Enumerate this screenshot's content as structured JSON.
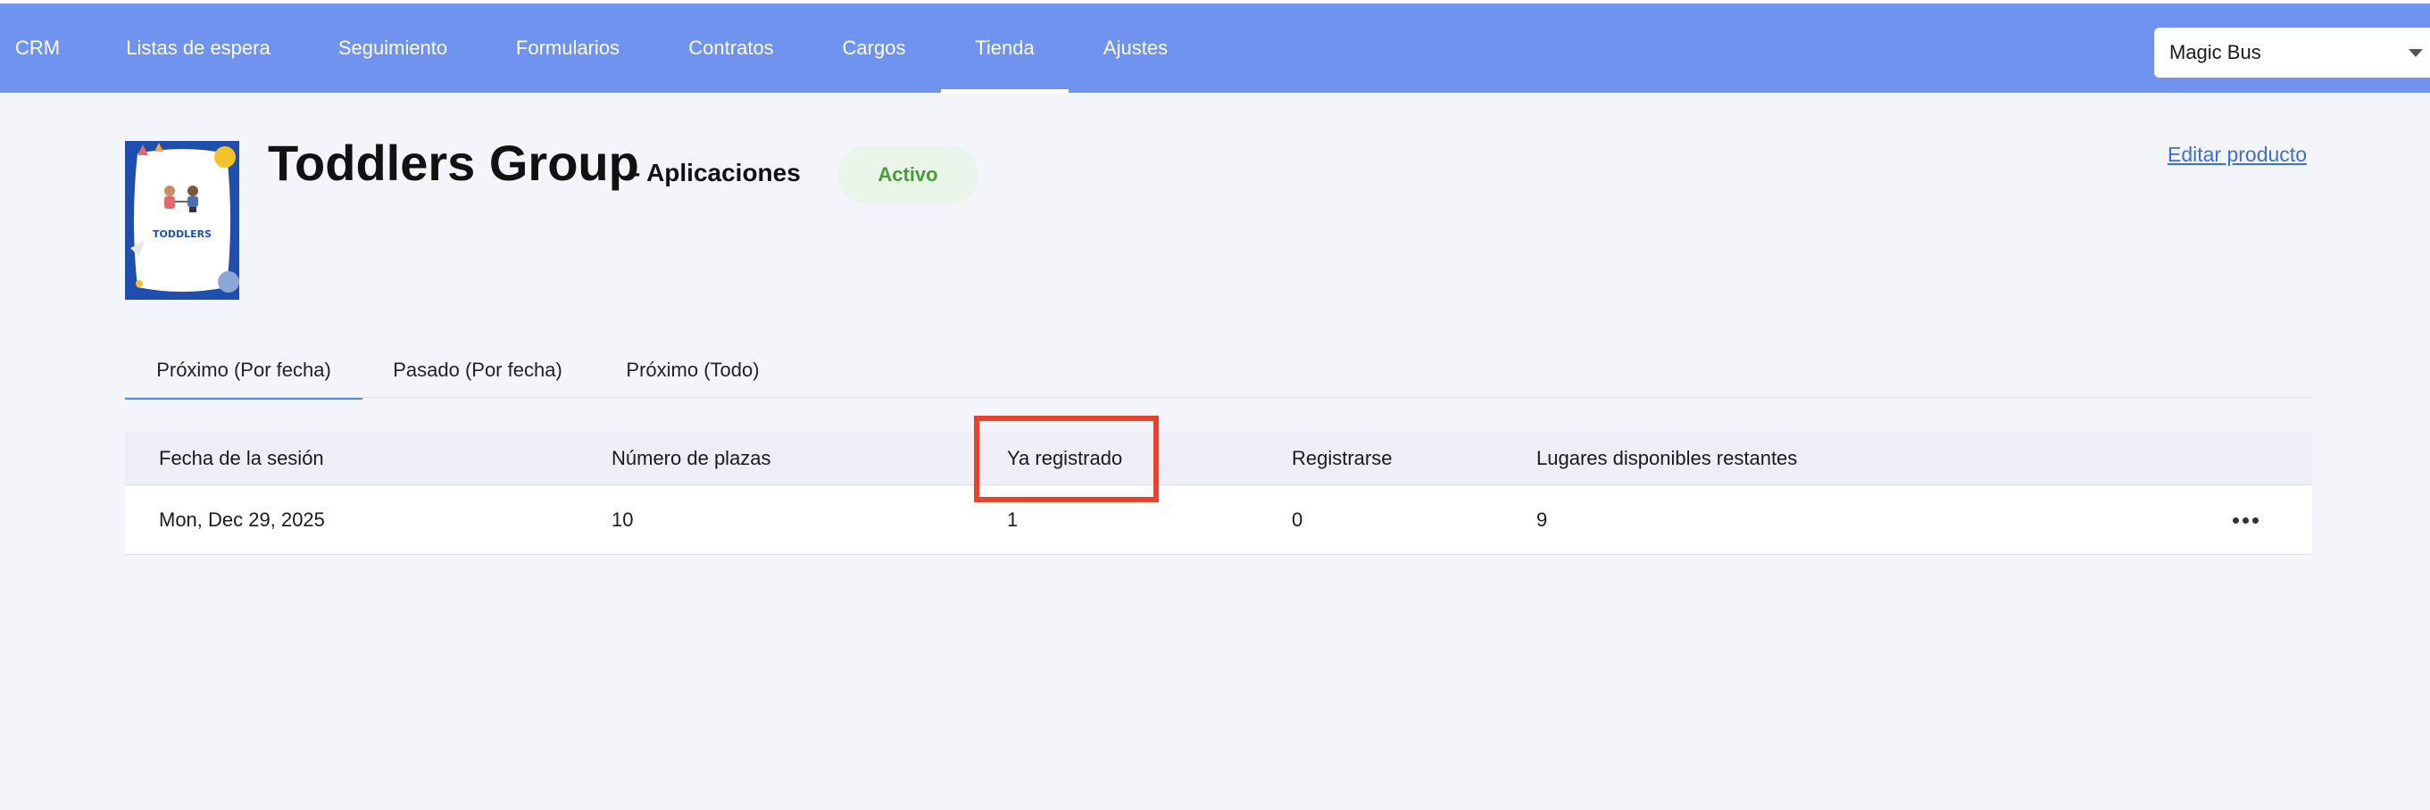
{
  "nav": {
    "items": [
      {
        "label": "CRM"
      },
      {
        "label": "Listas de espera"
      },
      {
        "label": "Seguimiento"
      },
      {
        "label": "Formularios"
      },
      {
        "label": "Contratos"
      },
      {
        "label": "Cargos"
      },
      {
        "label": "Tienda",
        "active": true
      },
      {
        "label": "Ajustes"
      }
    ],
    "org_selector": {
      "value": "Magic Bus"
    }
  },
  "product": {
    "image_text": "TODDLERS",
    "title": "Toddlers Group",
    "subtitle": "- Aplicaciones",
    "status": "Activo",
    "edit_link": "Editar producto"
  },
  "tabs": [
    {
      "label": "Próximo (Por fecha)",
      "active": true
    },
    {
      "label": "Pasado (Por fecha)"
    },
    {
      "label": "Próximo (Todo)"
    }
  ],
  "table": {
    "columns": [
      "Fecha de la sesión",
      "Número de plazas",
      "Ya registrado",
      "Registrarse",
      "Lugares disponibles restantes"
    ],
    "rows": [
      {
        "date": "Mon, Dec 29, 2025",
        "seats": "10",
        "registered": "1",
        "register": "0",
        "remaining": "9"
      }
    ]
  },
  "colors": {
    "topbar": "#6f93ee",
    "highlight": "#e8412c",
    "status_bg": "#e9f5e9",
    "status_text": "#4b9a3a",
    "link": "#3f6fd6"
  }
}
